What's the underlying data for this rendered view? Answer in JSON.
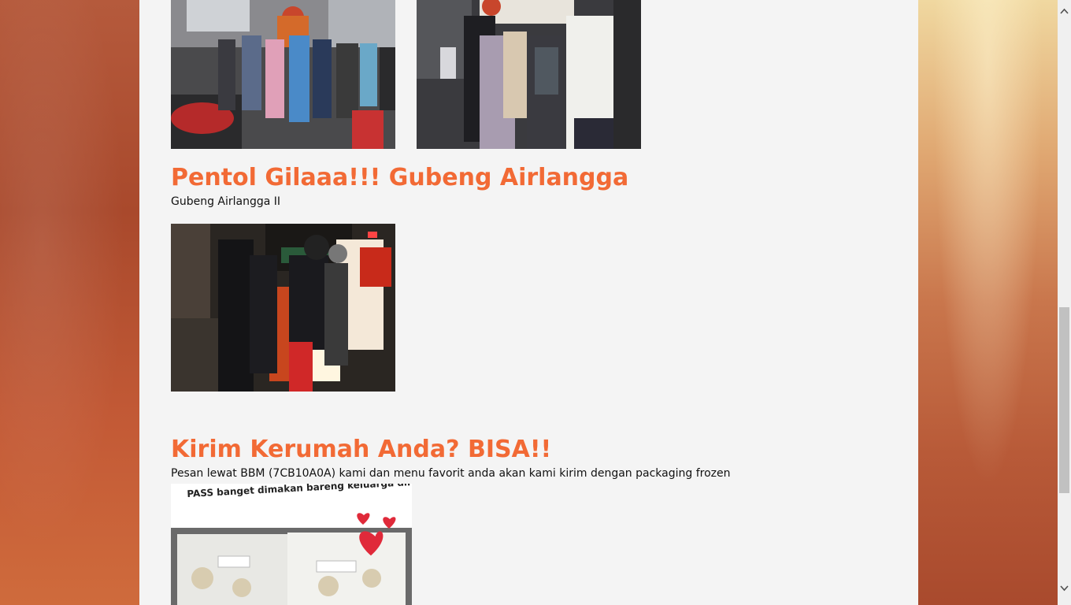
{
  "sections": {
    "gubeng": {
      "title": "Pentol Gilaaa!!! Gubeng Airlangga",
      "address": "Gubeng Airlangga II"
    },
    "delivery": {
      "title": "Kirim Kerumah Anda? BISA!!",
      "description": "Pesan lewat BBM (7CB10A0A) kami dan menu favorit anda akan kami kirim dengan packaging frozen",
      "banner_text": "PASS banget dimakan bareng keluarga dirumah. . ."
    }
  },
  "icons": {
    "scroll_up": "chevron-up-icon",
    "scroll_down": "chevron-down-icon"
  },
  "colors": {
    "heading": "#f26a35",
    "content_bg": "#f4f4f4",
    "scrollbar_thumb": "#c1c1c1"
  }
}
